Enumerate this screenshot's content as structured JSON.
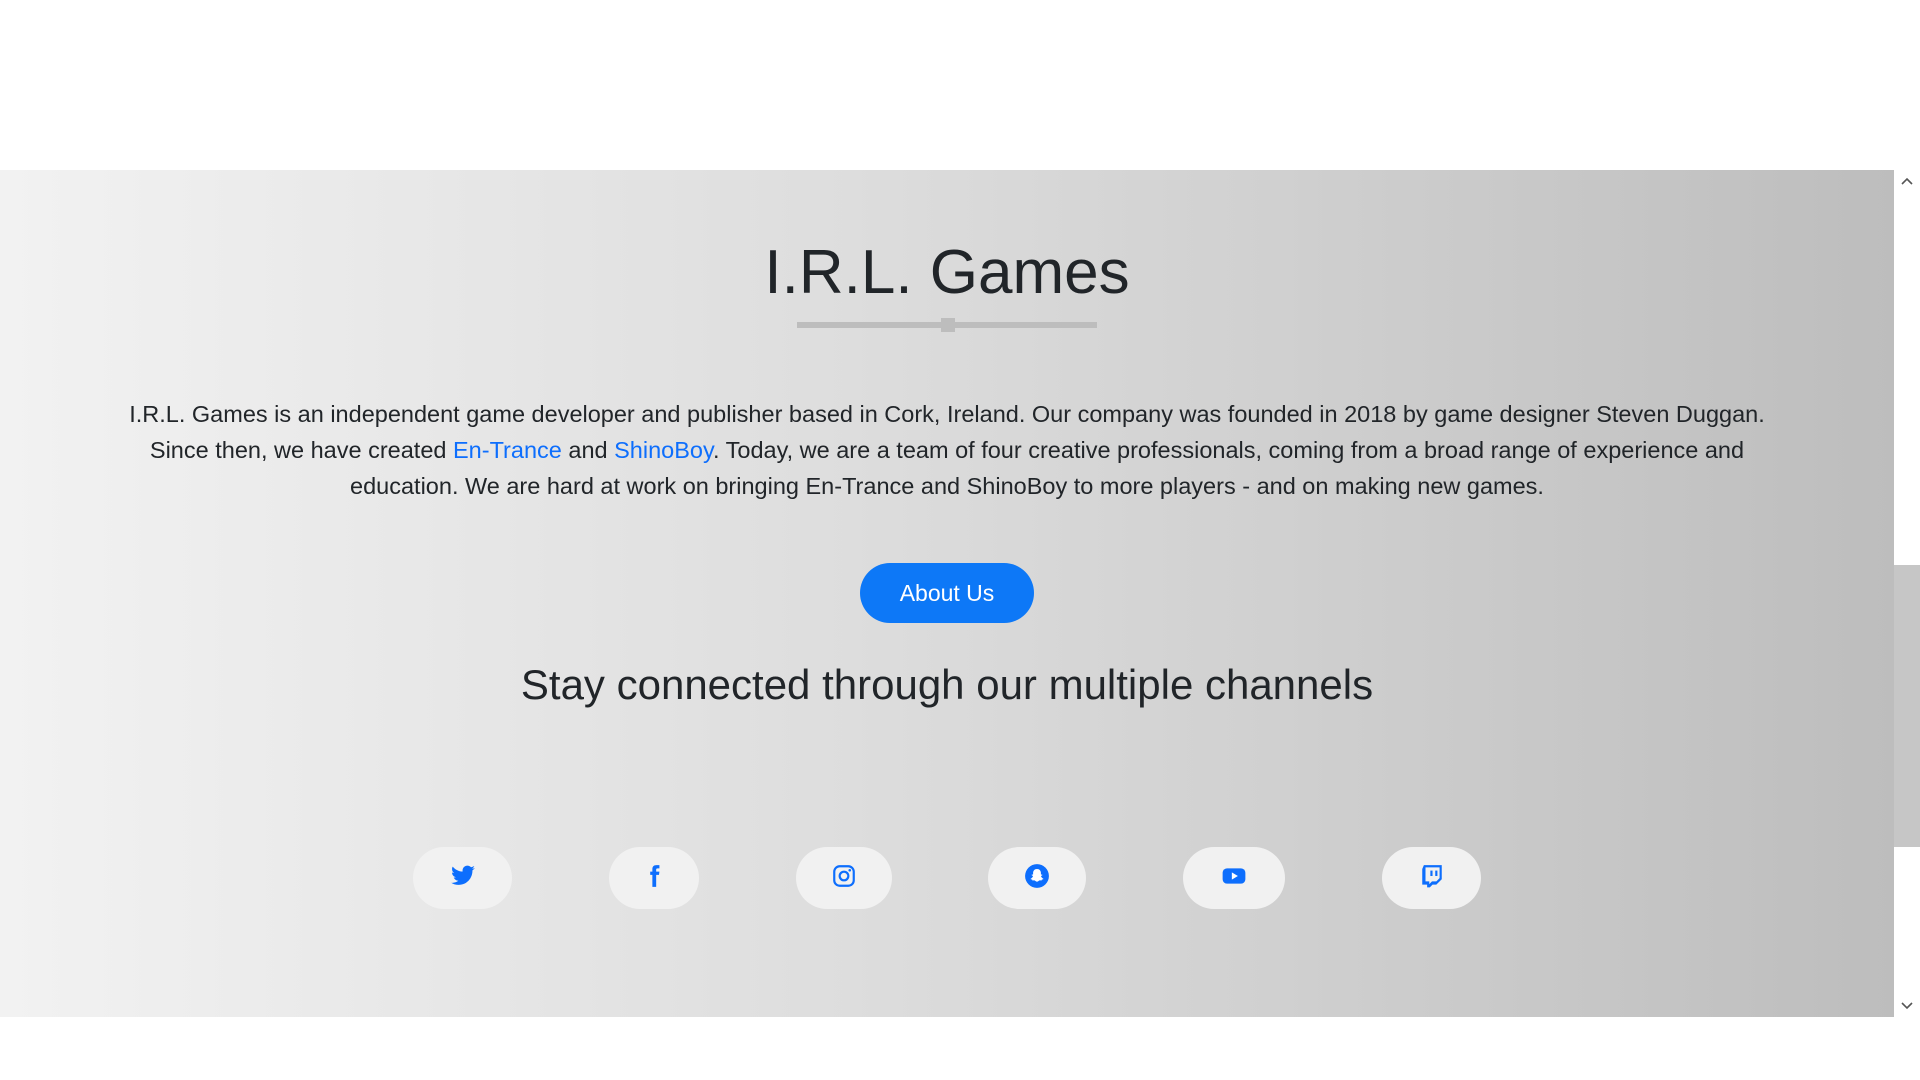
{
  "hero": {
    "title": "I.R.L. Games",
    "intro_part1": "I.R.L. Games is an independent game developer and publisher based in Cork, Ireland. Our company was founded in 2018 by game designer Steven Duggan. Since then, we have created ",
    "link_entrance": "En-Trance",
    "intro_and": " and ",
    "link_shinoboy": "ShinoBoy",
    "intro_part2": ". Today, we are a team of four creative professionals, coming from a broad range of experience and education. We are hard at work on bringing En-Trance and ShinoBoy to more players - and on making new games.",
    "about_button": "About Us",
    "subtitle": "Stay connected through our multiple channels"
  },
  "social": [
    {
      "icon": "twitter-icon"
    },
    {
      "icon": "facebook-icon"
    },
    {
      "icon": "instagram-icon"
    },
    {
      "icon": "snapchat-icon"
    },
    {
      "icon": "youtube-icon"
    },
    {
      "icon": "twitch-icon"
    }
  ],
  "colors": {
    "accent": "#0d78f7",
    "link": "#0d6efd",
    "icon": "#0d6efd",
    "social_bg": "#f1f1f1",
    "text": "#212529"
  },
  "scrollbar": {
    "up_arrow": "^",
    "down_arrow": "v"
  }
}
